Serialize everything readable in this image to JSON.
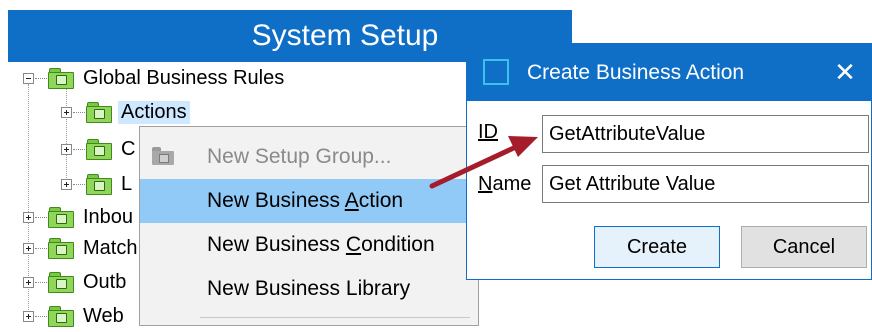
{
  "panel": {
    "title": "System Setup"
  },
  "tree": {
    "root": {
      "label": "Global Business Rules"
    },
    "children": [
      {
        "label": "Actions"
      },
      {
        "label": "C"
      },
      {
        "label": "L"
      }
    ],
    "siblings": [
      {
        "label": "Inbou"
      },
      {
        "label": "Match"
      },
      {
        "label": "Outb"
      },
      {
        "label": "Web"
      }
    ]
  },
  "context_menu": {
    "items": [
      {
        "label": "New Setup Group...",
        "state": "disabled",
        "icon": "folder-icon"
      },
      {
        "label": "New Business Action",
        "state": "highlighted",
        "accel": "A"
      },
      {
        "label": "New Business Condition",
        "accel": "C"
      },
      {
        "label": "New Business Library"
      }
    ]
  },
  "dialog": {
    "title": "Create Business Action",
    "close_glyph": "✕",
    "id_label": "ID",
    "id_value": "GetAttributeValue",
    "name_label": "Name",
    "name_value": "Get Attribute Value",
    "create_label": "Create",
    "cancel_label": "Cancel"
  },
  "colors": {
    "accent": "#0f6fc6",
    "highlight": "#91c9f7",
    "selection": "#cde8ff",
    "arrow": "#a51c2b",
    "folder": "#8fd65a"
  }
}
